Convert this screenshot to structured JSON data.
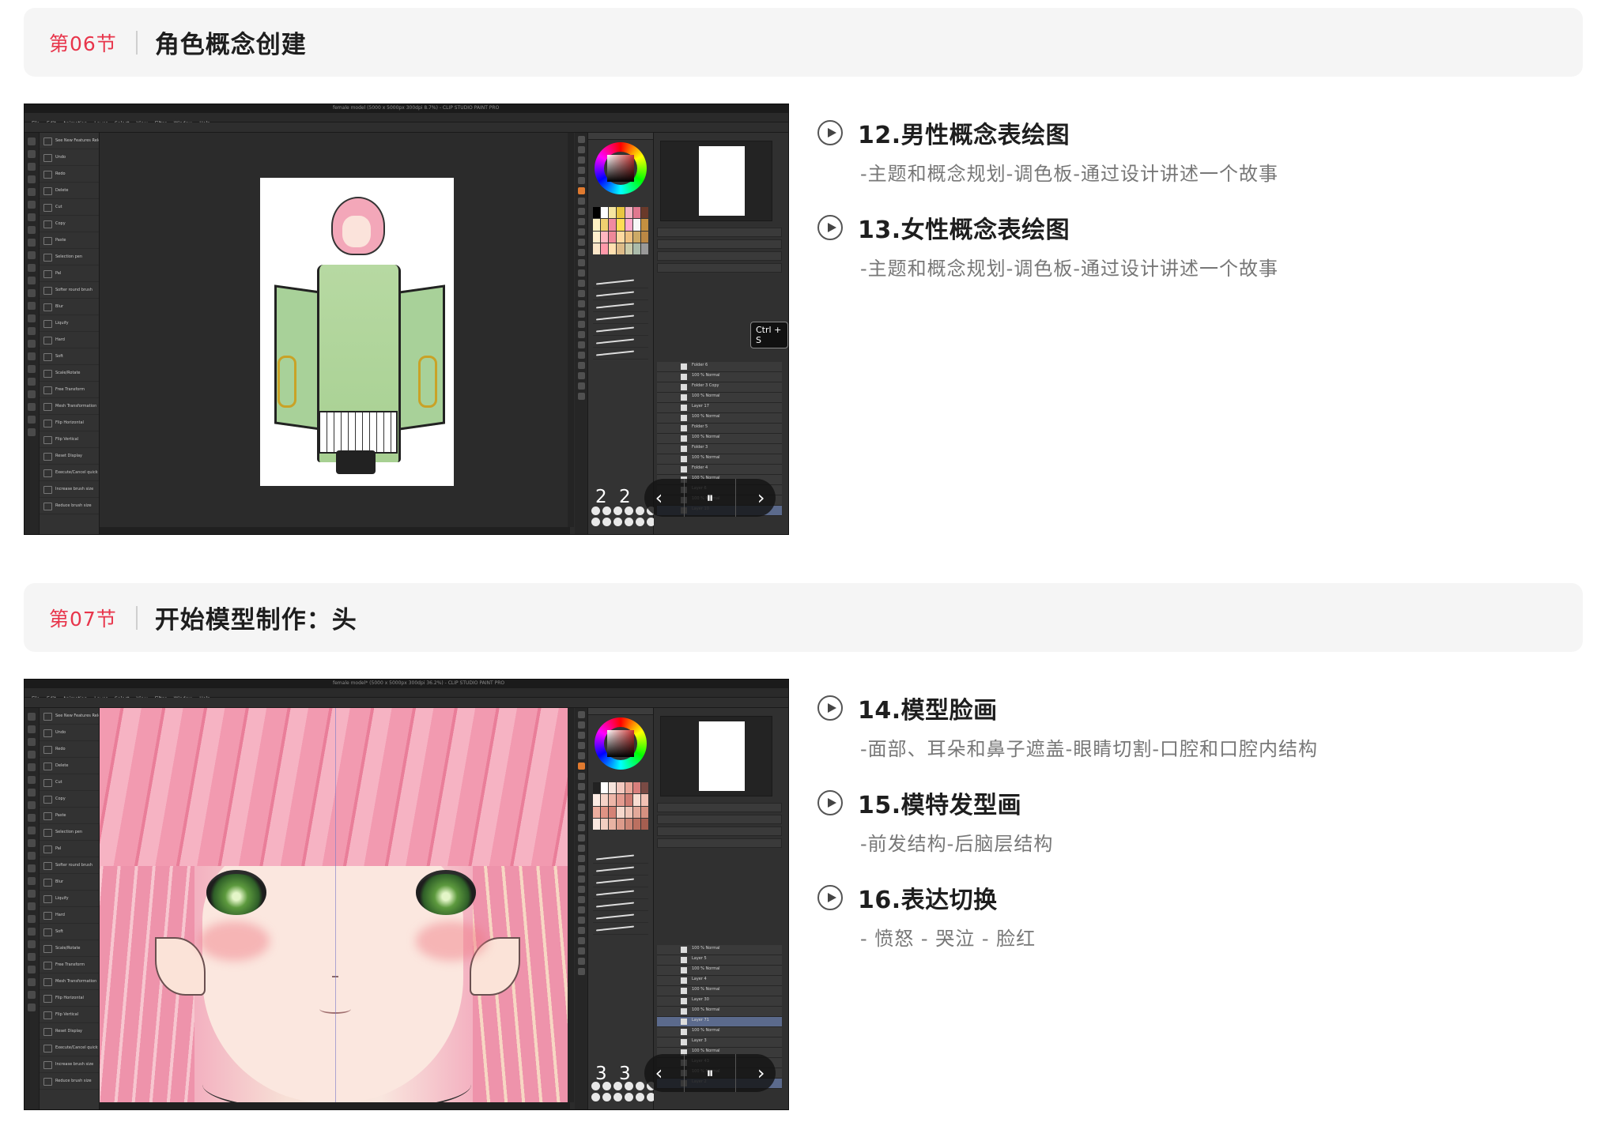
{
  "sections": [
    {
      "number": "第06节",
      "title": "角色概念创建",
      "screenshot": {
        "window_title": "female model (5000 x 5000px 300dpi 8.7%) - CLIP STUDIO PAINT PRO",
        "menu": [
          "File",
          "Edit",
          "Animation",
          "Layer",
          "Select",
          "View",
          "Filter",
          "Window",
          "Help"
        ],
        "quick_actions": [
          "See New Features Release Notes",
          "Undo",
          "Redo",
          "Delete",
          "Cut",
          "Copy",
          "Paste",
          "Selection pen",
          "Pal",
          "Softer round brush",
          "Blur",
          "Liquify",
          "Hard",
          "Soft",
          "Scale/Rotate",
          "Free Transform",
          "Mesh Transformation",
          "Flip Horizontal",
          "Flip Vertical",
          "Reset Display",
          "Execute/Cancel quick mask",
          "Increase brush size",
          "Reduce brush size"
        ],
        "layers": [
          "Folder 6",
          "100 % Normal",
          "Folder 3 Copy",
          "100 % Normal",
          "Layer 17",
          "100 % Normal",
          "Folder 5",
          "100 % Normal",
          "Folder 3",
          "100 % Normal",
          "Folder 4",
          "100 % Normal",
          "Layer 6",
          "100 % Normal",
          "Layer 10"
        ],
        "badge": "Ctrl + S",
        "counter": "2 2",
        "controls": {
          "prev": "‹",
          "pause": "⏸",
          "next": "›"
        }
      },
      "lessons": [
        {
          "title": "12.男性概念表绘图",
          "desc": "-主题和概念规划-调色板-通过设计讲述一个故事"
        },
        {
          "title": "13.女性概念表绘图",
          "desc": "-主题和概念规划-调色板-通过设计讲述一个故事"
        }
      ]
    },
    {
      "number": "第07节",
      "title": "开始模型制作：头",
      "screenshot": {
        "window_title": "female model* (5000 x 5000px 300dpi 36.2%) - CLIP STUDIO PAINT PRO",
        "menu": [
          "File",
          "Edit",
          "Animation",
          "Layer",
          "Select",
          "View",
          "Filter",
          "Window",
          "Help"
        ],
        "quick_actions": [
          "See New Features Release Notes",
          "Undo",
          "Redo",
          "Delete",
          "Cut",
          "Copy",
          "Paste",
          "Selection pen",
          "Pal",
          "Softer round brush",
          "Blur",
          "Liquify",
          "Hard",
          "Soft",
          "Scale/Rotate",
          "Free Transform",
          "Mesh Transformation",
          "Flip Horizontal",
          "Flip Vertical",
          "Reset Display",
          "Execute/Cancel quick mask",
          "Increase brush size",
          "Reduce brush size"
        ],
        "layers": [
          "100 % Normal",
          "Layer 5",
          "100 % Normal",
          "Layer 4",
          "100 % Normal",
          "Layer 30",
          "100 % Normal",
          "Layer 71",
          "100 % Normal",
          "Layer 3",
          "100 % Normal",
          "Layer 43",
          "100 % Normal",
          "Layer 2"
        ],
        "counter": "3 3",
        "controls": {
          "prev": "‹",
          "pause": "⏸",
          "next": "›"
        }
      },
      "lessons": [
        {
          "title": "14.模型脸画",
          "desc": "-面部、耳朵和鼻子遮盖-眼睛切割-口腔和口腔内结构"
        },
        {
          "title": "15.模特发型画",
          "desc": "-前发结构-后脑层结构"
        },
        {
          "title": "16.表达切换",
          "desc": "- 愤怒 - 哭泣 - 脸红"
        }
      ]
    }
  ],
  "colors": {
    "accent": "#e8354b",
    "header_bg": "#f5f5f5",
    "desc_text": "#777777"
  },
  "icons": {
    "lesson": "play-circle-icon"
  }
}
